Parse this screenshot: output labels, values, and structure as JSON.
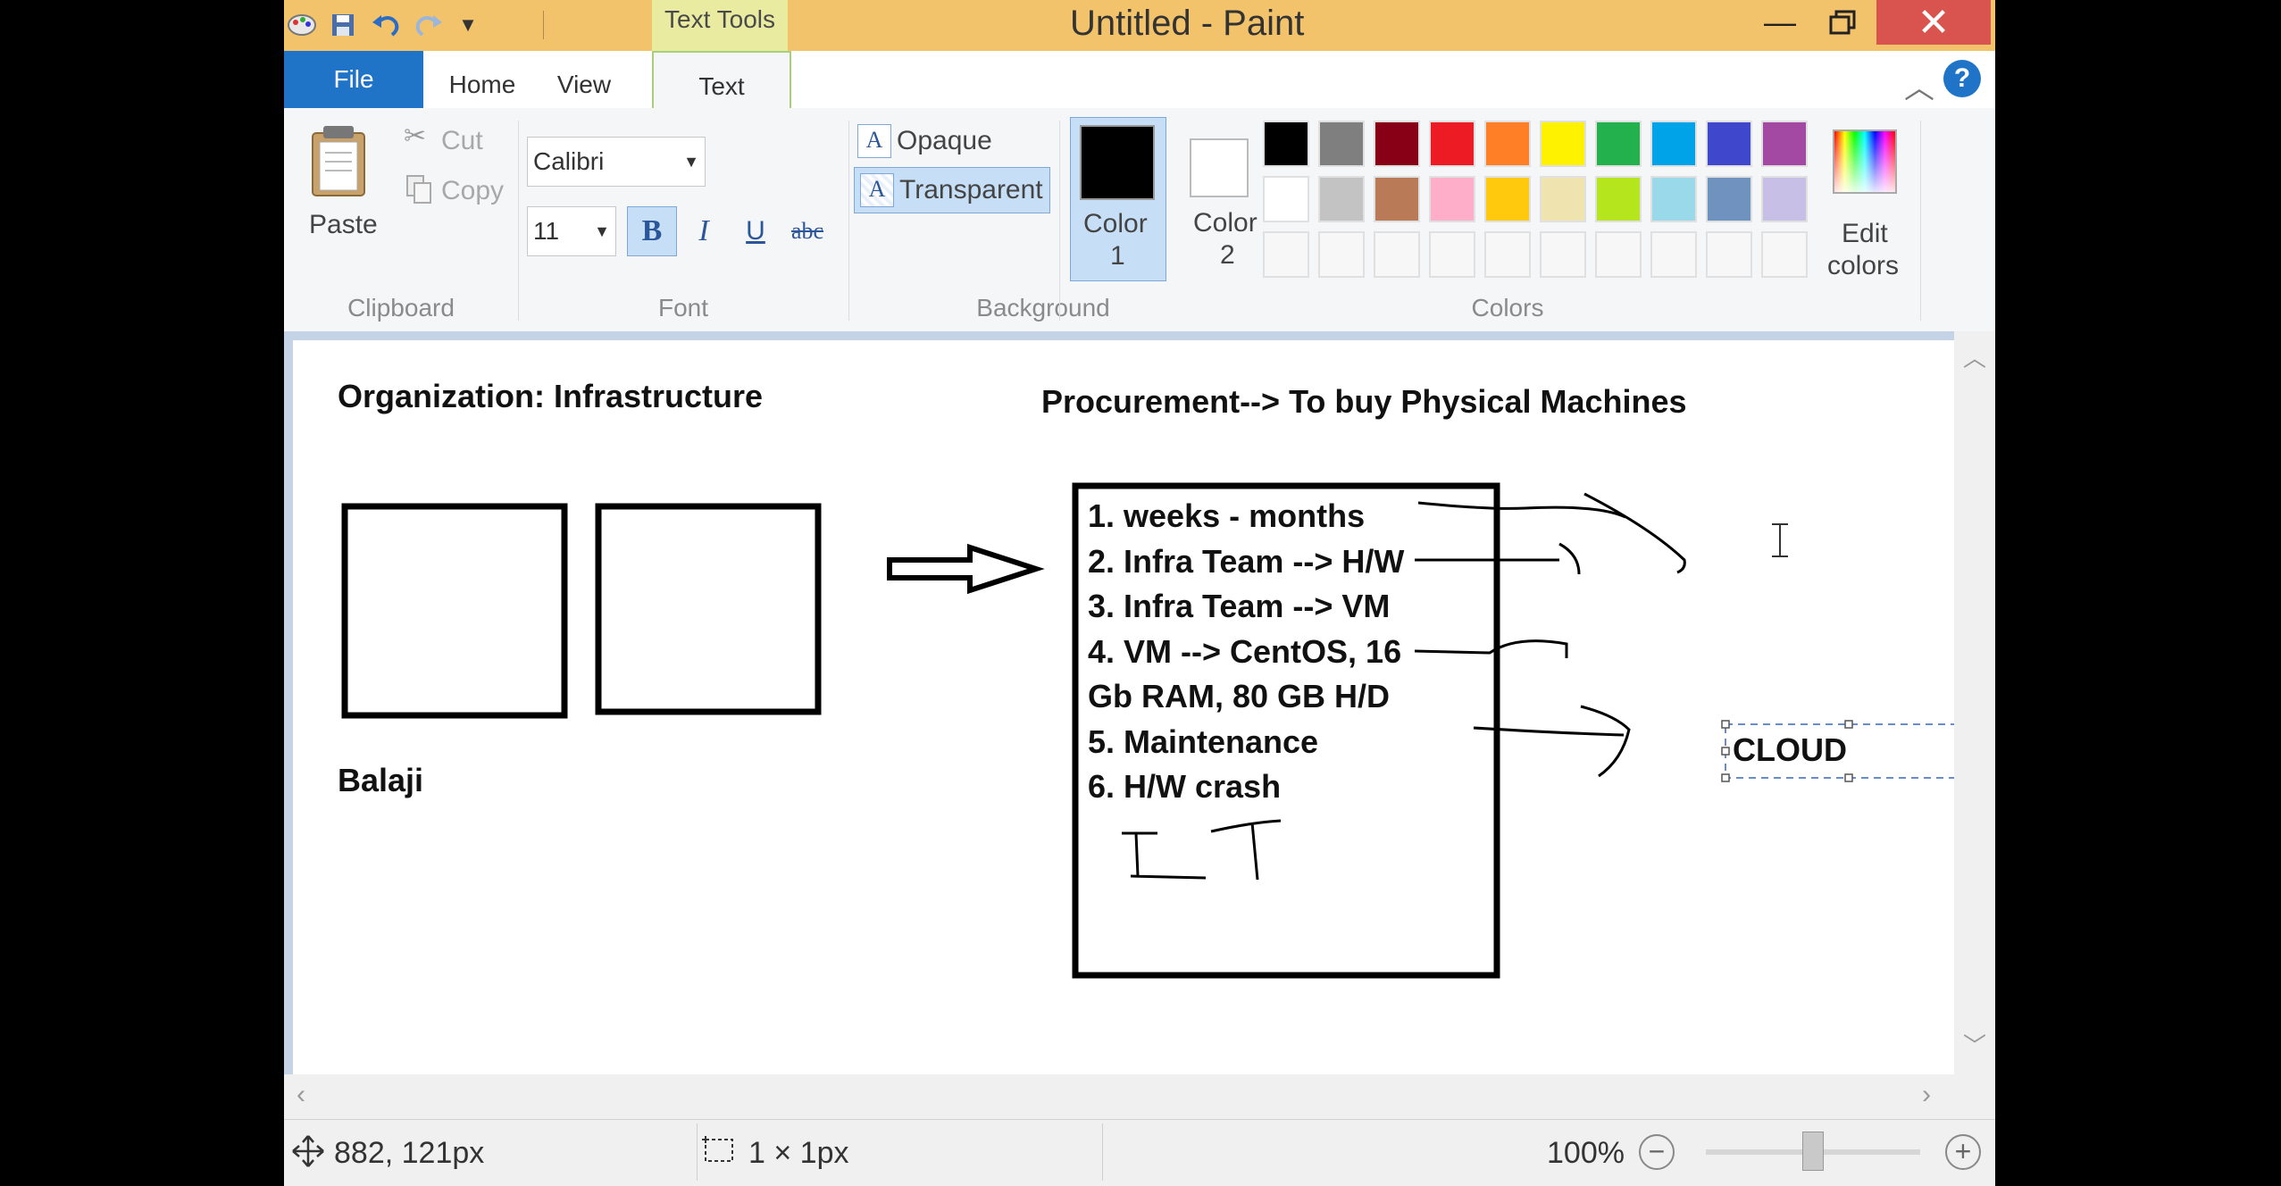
{
  "window": {
    "title": "Untitled - Paint",
    "contextual_tab": "Text Tools"
  },
  "tabs": {
    "file": "File",
    "home": "Home",
    "view": "View",
    "text": "Text"
  },
  "clipboard": {
    "paste": "Paste",
    "cut": "Cut",
    "copy": "Copy",
    "group": "Clipboard"
  },
  "font": {
    "family": "Calibri",
    "size": "11",
    "bold": "B",
    "italic": "I",
    "underline": "U",
    "strike": "abc",
    "group": "Font"
  },
  "background": {
    "opaque": "Opaque",
    "transparent": "Transparent",
    "group": "Background"
  },
  "colors": {
    "color1_line1": "Color",
    "color1_line2": "1",
    "color2_line1": "Color",
    "color2_line2": "2",
    "edit_line1": "Edit",
    "edit_line2": "colors",
    "group": "Colors",
    "color1": "#000000",
    "color2": "#ffffff",
    "palette_row1": [
      "#000000",
      "#7f7f7f",
      "#880015",
      "#ed1c24",
      "#ff7f27",
      "#fff200",
      "#22b14c",
      "#00a2e8",
      "#3f48cc",
      "#a349a4"
    ],
    "palette_row2": [
      "#ffffff",
      "#c3c3c3",
      "#b97a57",
      "#ffaec9",
      "#ffc90e",
      "#efe4b0",
      "#b5e61d",
      "#99d9ea",
      "#7092be",
      "#c8bfe7"
    ]
  },
  "canvas": {
    "org_heading": "Organization: Infrastructure",
    "procurement_heading": "Procurement--> To buy Physical Machines",
    "name": "Balaji",
    "list": [
      "1. weeks - months",
      "2. Infra Team --> H/W",
      "3. Infra Team --> VM",
      "4. VM --> CentOS, 16",
      "Gb RAM, 80 GB H/D",
      "5. Maintenance",
      "6. H/W crash"
    ],
    "textbox": "CLOUD"
  },
  "status": {
    "cursor_pos": "882, 121px",
    "selection": "1 × 1px",
    "zoom": "100%",
    "zoom_level": 0.5
  }
}
